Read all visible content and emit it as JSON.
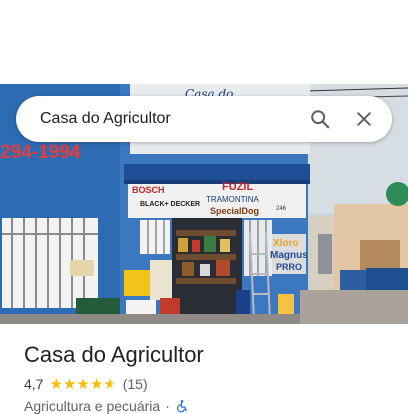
{
  "search": {
    "query": "Casa do Agricultor"
  },
  "place": {
    "name": "Casa do Agricultor",
    "rating": "4,7",
    "stars": 4.7,
    "reviews": "(15)",
    "category": "Agricultura e pecuária",
    "separator": "·"
  },
  "photo_signage": {
    "top_sign": "Casa do",
    "phone": "294-1994",
    "brand1": "BOSCH",
    "brand2": "BLACK+ DECKER",
    "brand3": "FUZIL",
    "brand4": "TRAMONTINA",
    "brand5": "SpecialDog",
    "brand6": "Xloro",
    "brand7": "Magnus",
    "brand8": "PRRO",
    "small_number": "246"
  },
  "colors": {
    "accent_star": "#fbbc04",
    "wall_blue": "#2f6bb3",
    "accessibility_blue": "#1a73e8"
  },
  "icons": {
    "search": "search-icon",
    "close": "close-icon",
    "accessibility": "wheelchair-icon"
  }
}
